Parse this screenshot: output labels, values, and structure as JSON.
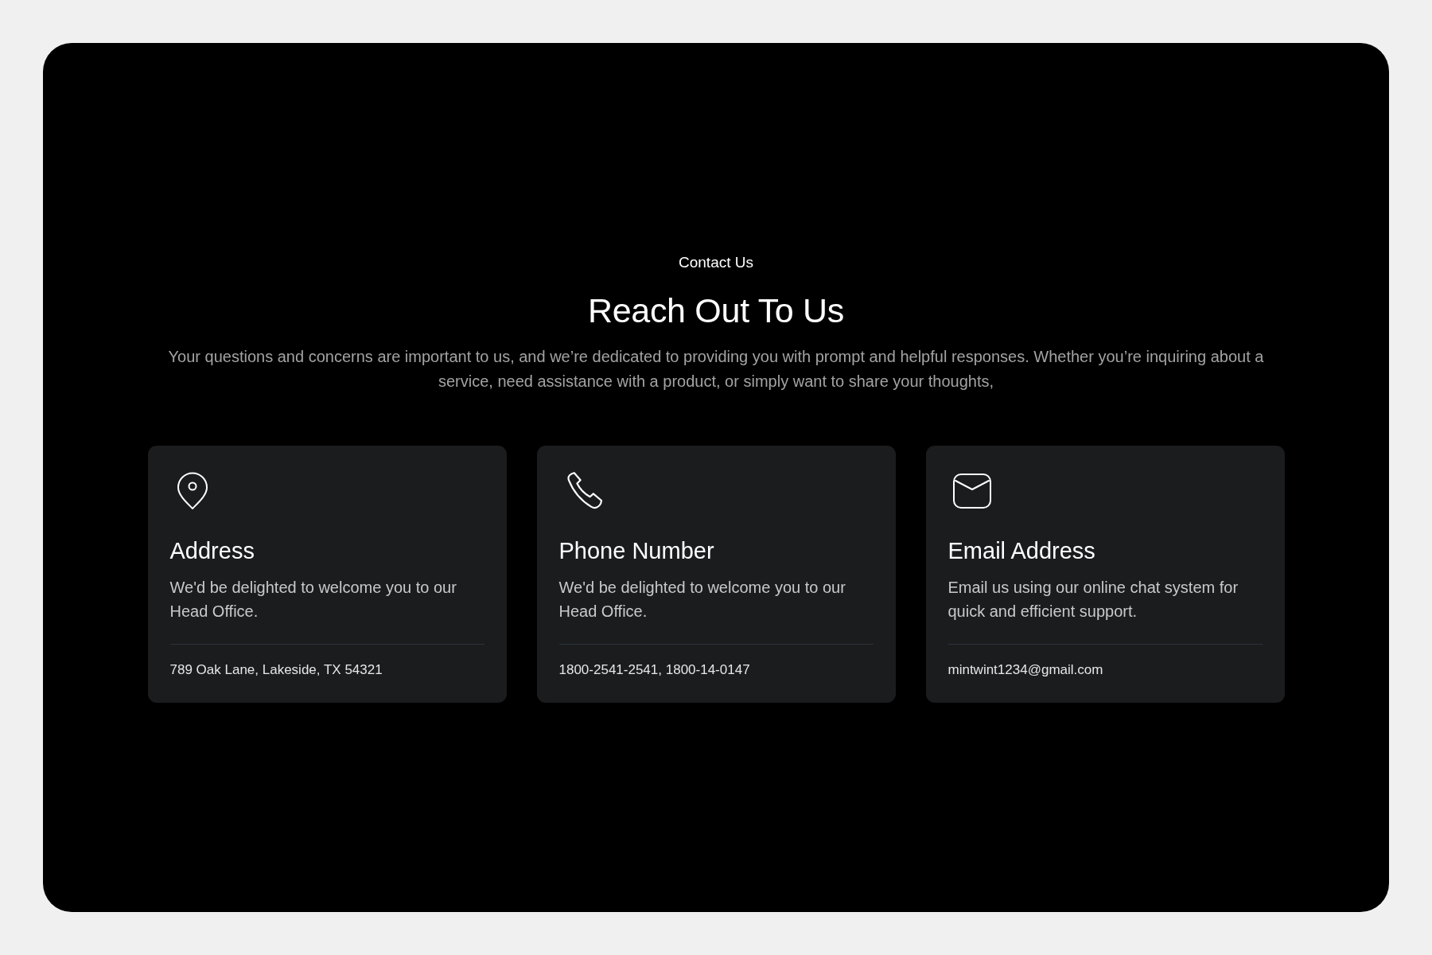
{
  "eyebrow": "Contact Us",
  "heading": "Reach Out To Us",
  "intro": "Your questions and concerns are important to us, and we’re dedicated to providing you with prompt and helpful responses. Whether you’re inquiring about a service, need assistance with a product, or simply want to share your thoughts,",
  "cards": [
    {
      "kind": "address",
      "title": "Address",
      "description": "We'd be delighted to welcome you to our Head Office.",
      "detail": "789 Oak Lane, Lakeside, TX 54321"
    },
    {
      "kind": "phone",
      "title": "Phone Number",
      "description": "We'd be delighted to welcome you to our Head Office.",
      "detail": "1800-2541-2541, 1800-14-0147"
    },
    {
      "kind": "email",
      "title": "Email Address",
      "description": "Email us using our online chat system for quick and efficient support.",
      "detail": "mintwint1234@gmail.com"
    }
  ]
}
